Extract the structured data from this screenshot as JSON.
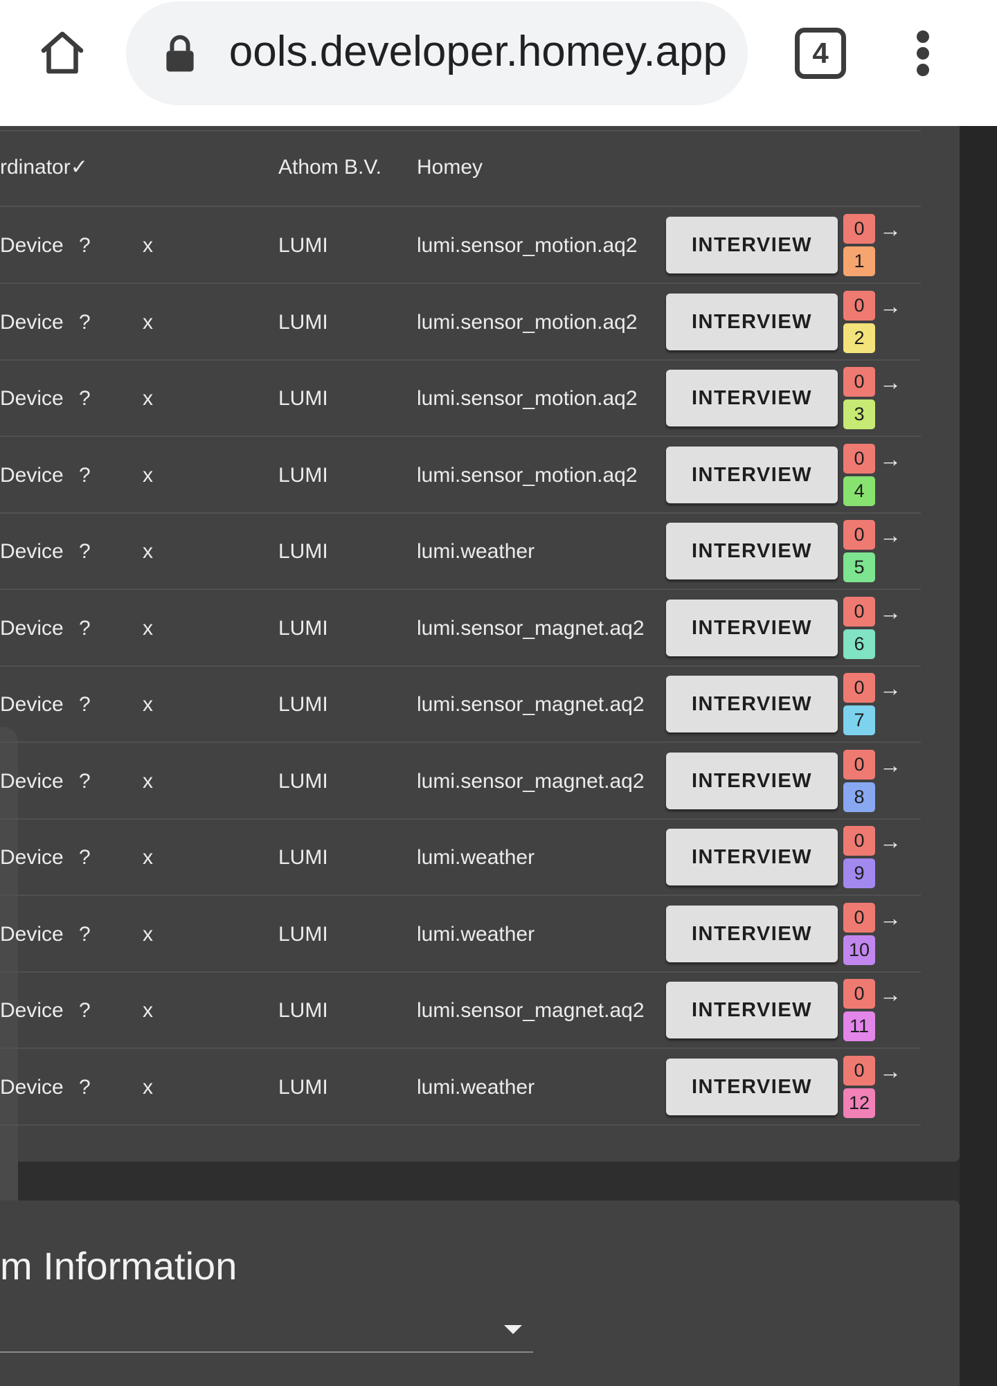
{
  "browser": {
    "url": "ools.developer.homey.app",
    "tab_count": "4"
  },
  "header_row": {
    "type": "rdinator✓",
    "manufacturer": "Athom B.V.",
    "model": "Homey"
  },
  "interview_label": "INTERVIEW",
  "arrow_glyph": "→",
  "devices": [
    {
      "type": "Device",
      "q": "?",
      "x": "x",
      "manufacturer": "LUMI",
      "model": "lumi.sensor_motion.aq2",
      "count_top": "0",
      "index": "1",
      "index_color": "#f6a56e"
    },
    {
      "type": "Device",
      "q": "?",
      "x": "x",
      "manufacturer": "LUMI",
      "model": "lumi.sensor_motion.aq2",
      "count_top": "0",
      "index": "2",
      "index_color": "#f2e37b"
    },
    {
      "type": "Device",
      "q": "?",
      "x": "x",
      "manufacturer": "LUMI",
      "model": "lumi.sensor_motion.aq2",
      "count_top": "0",
      "index": "3",
      "index_color": "#c6ea74"
    },
    {
      "type": "Device",
      "q": "?",
      "x": "x",
      "manufacturer": "LUMI",
      "model": "lumi.sensor_motion.aq2",
      "count_top": "0",
      "index": "4",
      "index_color": "#88e26f"
    },
    {
      "type": "Device",
      "q": "?",
      "x": "x",
      "manufacturer": "LUMI",
      "model": "lumi.weather",
      "count_top": "0",
      "index": "5",
      "index_color": "#7de48f"
    },
    {
      "type": "Device",
      "q": "?",
      "x": "x",
      "manufacturer": "LUMI",
      "model": "lumi.sensor_magnet.aq2",
      "count_top": "0",
      "index": "6",
      "index_color": "#7fe3c4"
    },
    {
      "type": "Device",
      "q": "?",
      "x": "x",
      "manufacturer": "LUMI",
      "model": "lumi.sensor_magnet.aq2",
      "count_top": "0",
      "index": "7",
      "index_color": "#7dd2ee"
    },
    {
      "type": "Device",
      "q": "?",
      "x": "x",
      "manufacturer": "LUMI",
      "model": "lumi.sensor_magnet.aq2",
      "count_top": "0",
      "index": "8",
      "index_color": "#89a8f2"
    },
    {
      "type": "Device",
      "q": "?",
      "x": "x",
      "manufacturer": "LUMI",
      "model": "lumi.weather",
      "count_top": "0",
      "index": "9",
      "index_color": "#a189f0"
    },
    {
      "type": "Device",
      "q": "?",
      "x": "x",
      "manufacturer": "LUMI",
      "model": "lumi.weather",
      "count_top": "0",
      "index": "10",
      "index_color": "#c187ef"
    },
    {
      "type": "Device",
      "q": "?",
      "x": "x",
      "manufacturer": "LUMI",
      "model": "lumi.sensor_magnet.aq2",
      "count_top": "0",
      "index": "11",
      "index_color": "#e386ea"
    },
    {
      "type": "Device",
      "q": "?",
      "x": "x",
      "manufacturer": "LUMI",
      "model": "lumi.weather",
      "count_top": "0",
      "index": "12",
      "index_color": "#f181b7"
    }
  ],
  "system_info": {
    "title": "m Information",
    "select_value": ""
  },
  "colors": {
    "page_bg": "#2e2e2e",
    "card_bg": "#424242",
    "button_bg": "#e0e0e0",
    "count_badge": "#ef7a72"
  }
}
